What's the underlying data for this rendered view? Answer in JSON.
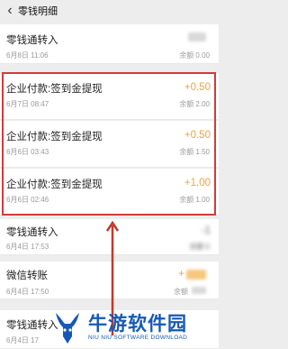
{
  "header": {
    "back_icon": "chevron-left-icon",
    "title": "零钱明细"
  },
  "rows": [
    {
      "name": "零钱通转入",
      "date": "6月8日 11:06",
      "amount": "-",
      "balance": "余额 0.00"
    },
    {
      "name": "企业付款:签到金提现",
      "date": "6月7日 08:47",
      "amount": "+0.50",
      "balance": "余额 2.00"
    },
    {
      "name": "企业付款:签到金提现",
      "date": "6月6日 03:43",
      "amount": "+0.50",
      "balance": "余额 1.50"
    },
    {
      "name": "企业付款:签到金提现",
      "date": "6月6日 02:46",
      "amount": "+1.00",
      "balance": "余额 1.00"
    },
    {
      "name": "零钱通转入",
      "date": "6月4日 17:53",
      "amount": "-1",
      "balance": "余额 0"
    },
    {
      "name": "微信转账",
      "date": "6月4日 17:50",
      "amount": "+",
      "balance": "余额"
    },
    {
      "name": "零钱通转入",
      "date": "6月4日 17",
      "amount": "",
      "balance": ""
    }
  ],
  "watermark": {
    "main": "牛游软件园",
    "sub": "NIU NIU SOFTWARE DOWNLOAD"
  },
  "colors": {
    "accent": "#f3a33b",
    "highlight": "#d23a3a",
    "watermark": "#1558b8"
  }
}
